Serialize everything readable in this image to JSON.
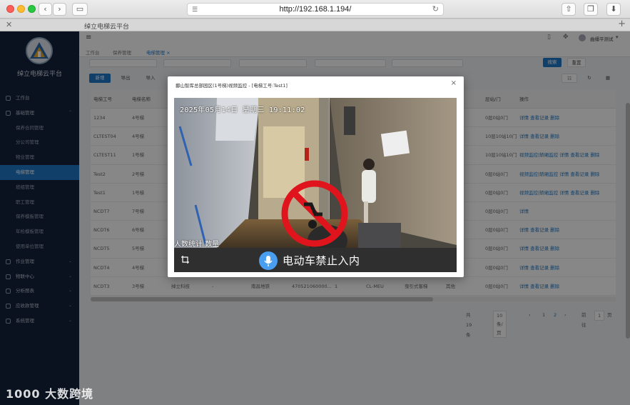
{
  "browser": {
    "url": "http://192.168.1.194/",
    "tab_title": "绰立电梯云平台",
    "tab_close": "✕",
    "new_tab": "+"
  },
  "app": {
    "logo_title": "绰立电梯云平台",
    "user": "曲缰平测试",
    "menu": [
      {
        "label": "工作台",
        "level": "top"
      },
      {
        "label": "基础管理",
        "level": "top",
        "caret": "⌃"
      },
      {
        "label": "保养合同管理",
        "level": "sub"
      },
      {
        "label": "分公司管理",
        "level": "sub"
      },
      {
        "label": "物业管理",
        "level": "sub"
      },
      {
        "label": "电梯管理",
        "level": "sub",
        "active": true
      },
      {
        "label": "班组管理",
        "level": "sub"
      },
      {
        "label": "职工管理",
        "level": "sub"
      },
      {
        "label": "保养模板管理",
        "level": "sub"
      },
      {
        "label": "年检模板管理",
        "level": "sub"
      },
      {
        "label": "使用单位管理",
        "level": "sub"
      },
      {
        "label": "作业管理",
        "level": "top",
        "caret": "⌄"
      },
      {
        "label": "物联中心",
        "level": "top",
        "caret": "⌄"
      },
      {
        "label": "分析图表",
        "level": "top",
        "caret": "⌄"
      },
      {
        "label": "应收款管理",
        "level": "top",
        "caret": "⌄"
      },
      {
        "label": "系统管理",
        "level": "top",
        "caret": "⌄"
      }
    ],
    "breadcrumbs": [
      "工作台",
      "保养管理",
      "电梯管理 ×"
    ],
    "buttons": {
      "add": "新增",
      "export": "导出",
      "import": "导入",
      "search": "搜索",
      "reset": "重置"
    },
    "table": {
      "headers": [
        "电梯工号",
        "电梯名称",
        "",
        "",
        "",
        "",
        "",
        "",
        "",
        "层站/门",
        "操作"
      ],
      "rows": [
        {
          "id": "1234",
          "name": "4号梯",
          "c3": "",
          "c4": "",
          "c5": "",
          "c6": "",
          "c7": "",
          "c8": "",
          "c9": "",
          "floors": "0层0站0门",
          "ops": "详情  查看记录  删除"
        },
        {
          "id": "CLTEST04",
          "name": "4号梯",
          "c3": "",
          "c4": "",
          "c5": "",
          "c6": "",
          "c7": "",
          "c8": "",
          "c9": "",
          "floors": "10层10站10门",
          "ops": "详情  查看记录  删除"
        },
        {
          "id": "CLTEST11",
          "name": "1号梯",
          "c3": "",
          "c4": "",
          "c5": "",
          "c6": "",
          "c7": "",
          "c8": "",
          "c9": "",
          "floors": "10层10站10门",
          "ops": "视频监控|轿厢监控  详情  查看记录  删除"
        },
        {
          "id": "Test2",
          "name": "2号梯",
          "c3": "",
          "c4": "",
          "c5": "",
          "c6": "",
          "c7": "",
          "c8": "",
          "c9": "",
          "floors": "0层0站0门",
          "ops": "视频监控|轿厢监控  详情  查看记录  删除"
        },
        {
          "id": "Test1",
          "name": "1号梯",
          "c3": "",
          "c4": "",
          "c5": "",
          "c6": "",
          "c7": "",
          "c8": "",
          "c9": "",
          "floors": "0层0站0门",
          "ops": "视频监控|轿厢监控  详情  查看记录  删除"
        },
        {
          "id": "NCDT7",
          "name": "7号梯",
          "c3": "",
          "c4": "",
          "c5": "",
          "c6": "",
          "c7": "",
          "c8": "",
          "c9": "",
          "floors": "0层0站0门",
          "ops": "详情"
        },
        {
          "id": "NCDT6",
          "name": "6号梯",
          "c3": "",
          "c4": "",
          "c5": "",
          "c6": "",
          "c7": "",
          "c8": "",
          "c9": "",
          "floors": "0层0站0门",
          "ops": "详情  查看记录  删除"
        },
        {
          "id": "NCDT5",
          "name": "5号梯",
          "c3": "",
          "c4": "",
          "c5": "",
          "c6": "",
          "c7": "",
          "c8": "",
          "c9": "",
          "floors": "0层0站0门",
          "ops": "详情  查看记录  删除"
        },
        {
          "id": "NCDT4",
          "name": "4号梯",
          "c3": "",
          "c4": "",
          "c5": "",
          "c6": "",
          "c7": "",
          "c8": "",
          "c9": "",
          "floors": "0层0站0门",
          "ops": "详情  查看记录  删除"
        },
        {
          "id": "NCDT3",
          "name": "3号梯",
          "c3": "绰立科技",
          "c4": "-",
          "c5": "南昌地铁",
          "c6": "470521060000...",
          "c7": "1",
          "c8": "CL-MEU",
          "c9": "曳引式客梯",
          "c10": "其他",
          "floors": "0层0站0门",
          "ops": "详情  查看记录  删除"
        }
      ]
    },
    "pager": {
      "total": "共 19 条",
      "page_size": "10条/页",
      "prev": "‹",
      "p1": "1",
      "p2": "2",
      "next": "›",
      "goto_label": "前往",
      "goto_value": "1",
      "page_unit": "页"
    }
  },
  "modal": {
    "title": "鄱山智库总部园区(1号梯)视频监控 - [电梯工号:Test1]",
    "close": "×",
    "osd_time": "2025年05月14日  星期三  19:11:02",
    "osd_count": "人数统计 数量",
    "caption": "电动车禁止入内",
    "icons": {
      "crop": "crop-icon",
      "mic": "microphone-icon"
    },
    "colors": {
      "no_sign": "#e0141c",
      "mic_bg": "#4a9ef0"
    }
  },
  "watermark": "1000 大数跨境"
}
